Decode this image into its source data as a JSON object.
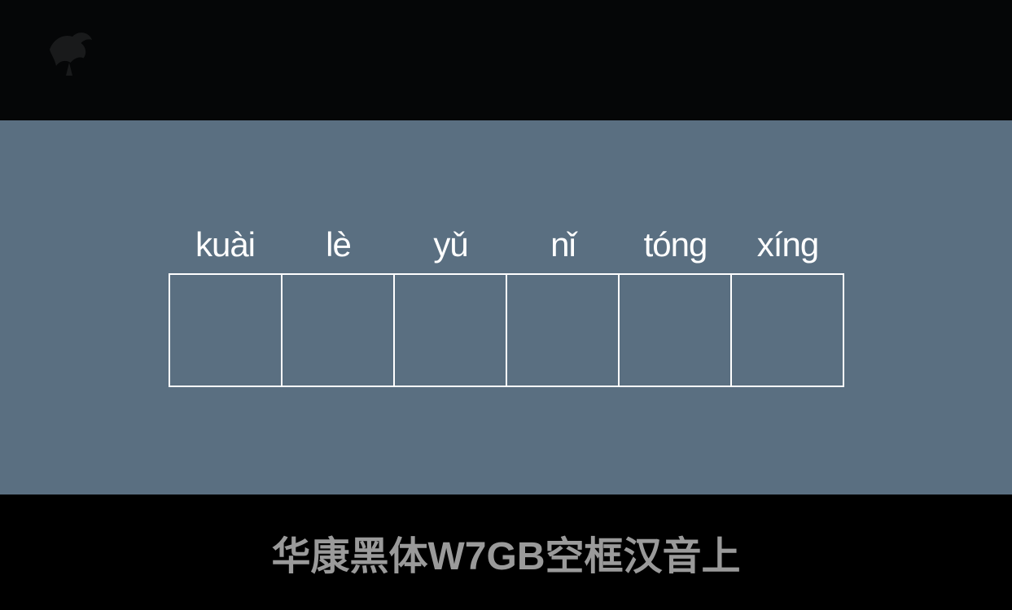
{
  "font_name": "华康黑体W7GB空框汉音上",
  "sample": {
    "cells": [
      {
        "pinyin": "kuài"
      },
      {
        "pinyin": "lè"
      },
      {
        "pinyin": "yǔ"
      },
      {
        "pinyin": "nǐ"
      },
      {
        "pinyin": "tóng"
      },
      {
        "pinyin": "xíng"
      }
    ]
  },
  "colors": {
    "panel_bg": "#5a6f81",
    "text": "#ffffff",
    "footer_text": "#9a9a9a",
    "frame": "#000000"
  }
}
